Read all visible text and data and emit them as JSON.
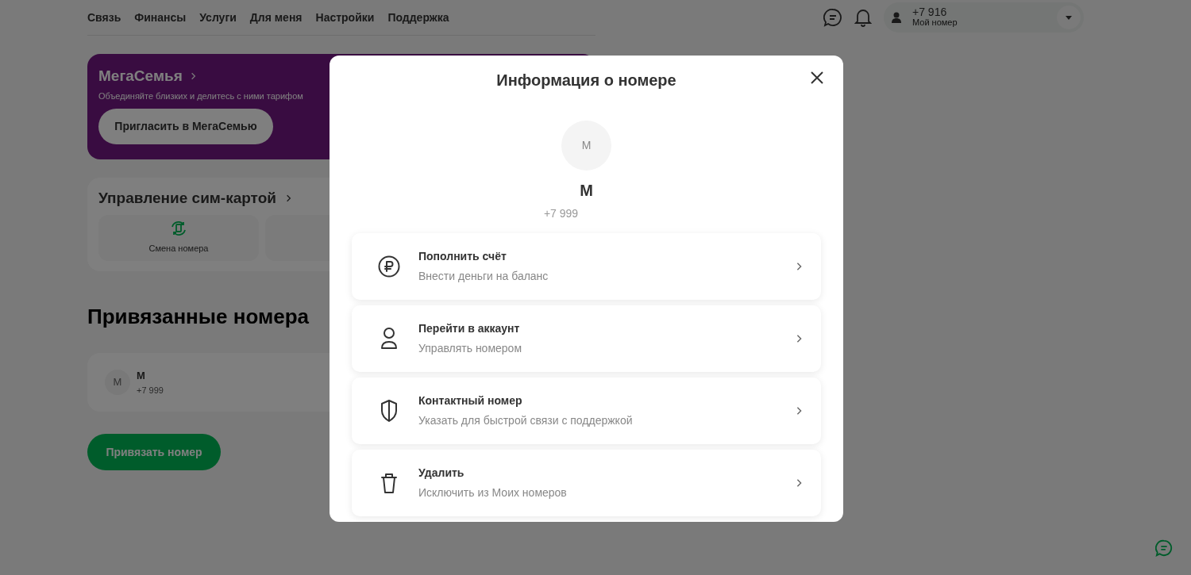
{
  "nav": {
    "items": [
      "Связь",
      "Финансы",
      "Услуги",
      "Для меня",
      "Настройки",
      "Поддержка"
    ]
  },
  "account": {
    "phone": "+7 916",
    "label": "Мой номер"
  },
  "megafamily": {
    "title": "МегаСемья",
    "subtitle": "Объединяйте близких и делитесь с ними тарифом",
    "button": "Пригласить в МегаСемью"
  },
  "sim": {
    "title": "Управление сим-картой",
    "tiles": [
      {
        "kind": "swap",
        "label": "Смена номера"
      },
      {
        "kind": "none"
      }
    ]
  },
  "linked": {
    "title": "Привязанные номера",
    "numbers": [
      {
        "initial": "М",
        "name": "М",
        "phone": "+7 999"
      }
    ],
    "button": "Привязать номер"
  },
  "modal": {
    "title": "Информация о номере",
    "avatar_initial": "М",
    "name": "М",
    "phone": "+7 999",
    "actions": [
      {
        "kind": "ruble",
        "title": "Пополнить счёт",
        "subtitle": "Внести деньги на баланс"
      },
      {
        "kind": "person",
        "title": "Перейти в аккаунт",
        "subtitle": "Управлять номером"
      },
      {
        "kind": "shield",
        "title": "Контактный номер",
        "subtitle": "Указать для быстрой связи с поддержкой"
      },
      {
        "kind": "trash",
        "title": "Удалить",
        "subtitle": "Исключить из Моих номеров"
      }
    ]
  }
}
